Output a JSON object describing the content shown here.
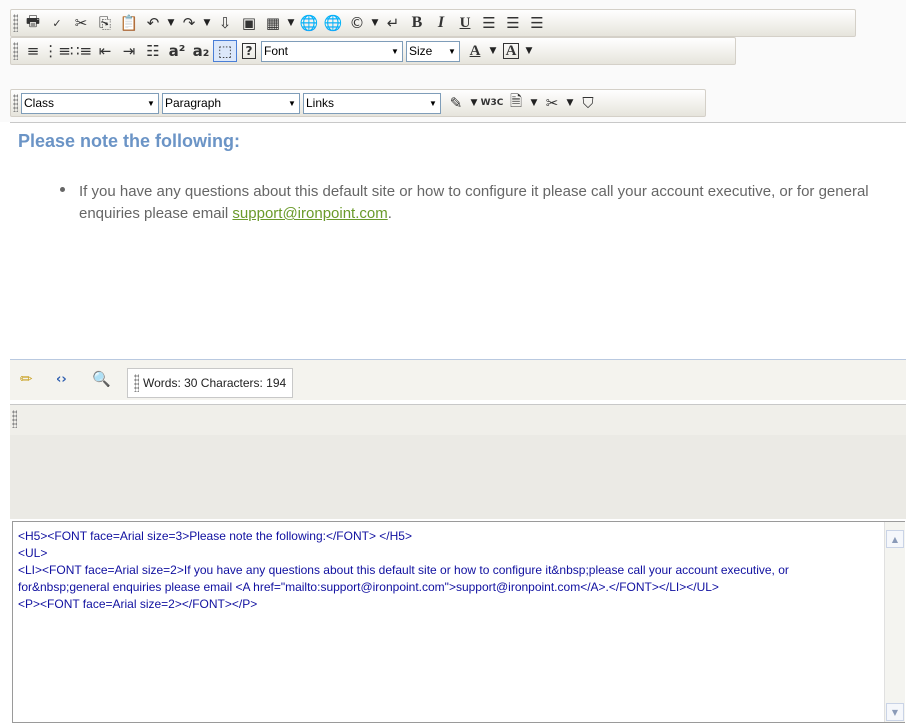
{
  "toolbar": {
    "row3": {
      "class_combo": "Class",
      "paragraph_combo": "Paragraph",
      "links_combo": "Links",
      "w3c_label": "W3C"
    },
    "row2": {
      "font_combo": "Font",
      "size_combo": "Size",
      "help_label": "?",
      "bold_label": "B",
      "italic_label": "I",
      "underline_label": "U"
    }
  },
  "design": {
    "heading": "Please note the following:",
    "bullet_text": "If you have any questions about this default site or how to configure it please call your account executive, or for general enquiries please email ",
    "email_link": "support@ironpoint.com",
    "trailing": "."
  },
  "statusbar": {
    "stats": "Words: 30 Characters: 194"
  },
  "source": {
    "code": "<H5><FONT face=Arial size=3>Please note the following:</FONT> </H5>\n<UL>\n<LI><FONT face=Arial size=2>If you have any questions about this default site or how to configure it&nbsp;please call your account executive, or for&nbsp;general enquiries please email <A href=\"mailto:support@ironpoint.com\">support@ironpoint.com</A>.</FONT></LI></UL>\n<P><FONT face=Arial size=2></FONT></P>"
  },
  "colors": {
    "heading": "#6b94c6",
    "link": "#6a9a2a",
    "source_text": "#1010a0",
    "selected_button_border": "#4a7ed6"
  }
}
